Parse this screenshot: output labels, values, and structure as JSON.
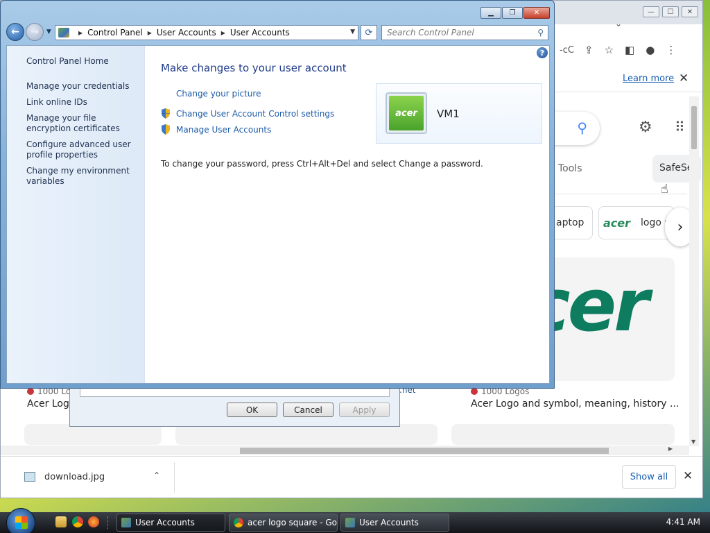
{
  "chrome": {
    "tab_dropdown_icon": "chevron-down-icon",
    "window_buttons": [
      "minimize-icon",
      "maximize-icon",
      "close-icon"
    ],
    "omnibox_text": "-cC",
    "learn_more": "Learn more",
    "tools_label": "Tools",
    "safesearch_label": "SafeSe",
    "chip_laptop": "aptop",
    "chip_logo_mark": "acer",
    "chip_logo_text": "logo p",
    "result_logo_text": "cer",
    "result1_source": "1000 Lo",
    "result1_title": "Acer Logo",
    "result2_source": "1000 Logos",
    "result2_title": "Acer Logo and symbol, meaning, history ...",
    "ghost_text": ".net",
    "download_file": "download.jpg",
    "show_all": "Show all"
  },
  "dialog": {
    "ok": "OK",
    "cancel": "Cancel",
    "apply": "Apply"
  },
  "control_panel": {
    "breadcrumb": [
      "Control Panel",
      "User Accounts",
      "User Accounts"
    ],
    "search_placeholder": "Search Control Panel",
    "left_nav": [
      "Control Panel Home",
      "Manage your credentials",
      "Link online IDs",
      "Manage your file encryption certificates",
      "Configure advanced user profile properties",
      "Change my environment variables"
    ],
    "heading": "Make changes to your user account",
    "tasks": [
      "Change your picture",
      "Change User Account Control settings",
      "Manage User Accounts"
    ],
    "password_note": "To change your password, press Ctrl+Alt+Del and select Change a password.",
    "account_name": "VM1",
    "account_logo": "acer",
    "help": "?"
  },
  "taskbar": {
    "buttons": [
      "User Accounts",
      "acer logo square - Go...",
      "User Accounts"
    ],
    "clock": "4:41 AM"
  }
}
